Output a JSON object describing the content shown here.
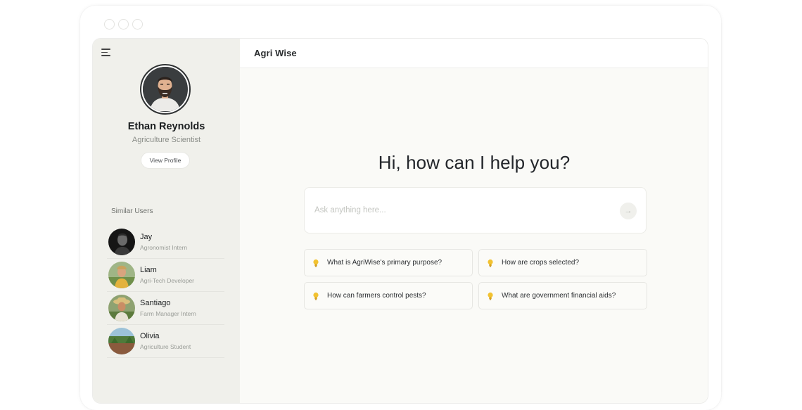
{
  "window": {
    "controls": [
      "close",
      "minimize",
      "maximize"
    ]
  },
  "app": {
    "title": "Agri Wise"
  },
  "sidebar": {
    "menu_icon": "hamburger-menu-icon",
    "profile": {
      "name": "Ethan Reynolds",
      "role": "Agriculture Scientist",
      "view_profile_label": "View Profile"
    },
    "similar_users_title": "Similar Users",
    "users": [
      {
        "name": "Jay",
        "role": "Agronomist Intern"
      },
      {
        "name": "Liam",
        "role": "Agri-Tech Developer"
      },
      {
        "name": "Santiago",
        "role": "Farm Manager Intern"
      },
      {
        "name": "Olivia",
        "role": "Agriculture Student"
      }
    ]
  },
  "main": {
    "greeting": "Hi, how can I help you?",
    "ask": {
      "placeholder": "Ask anything here...",
      "send_icon": "arrow-right-icon"
    },
    "suggestions": [
      "What is AgriWise's primary purpose?",
      "How are crops selected?",
      "How can farmers control pests?",
      "What are government financial aids?"
    ],
    "suggestion_icon": "lightbulb-icon"
  },
  "colors": {
    "sidebar_bg": "#f0f0eb",
    "main_bg": "#fafaf7",
    "bulb": "#f2c230"
  }
}
